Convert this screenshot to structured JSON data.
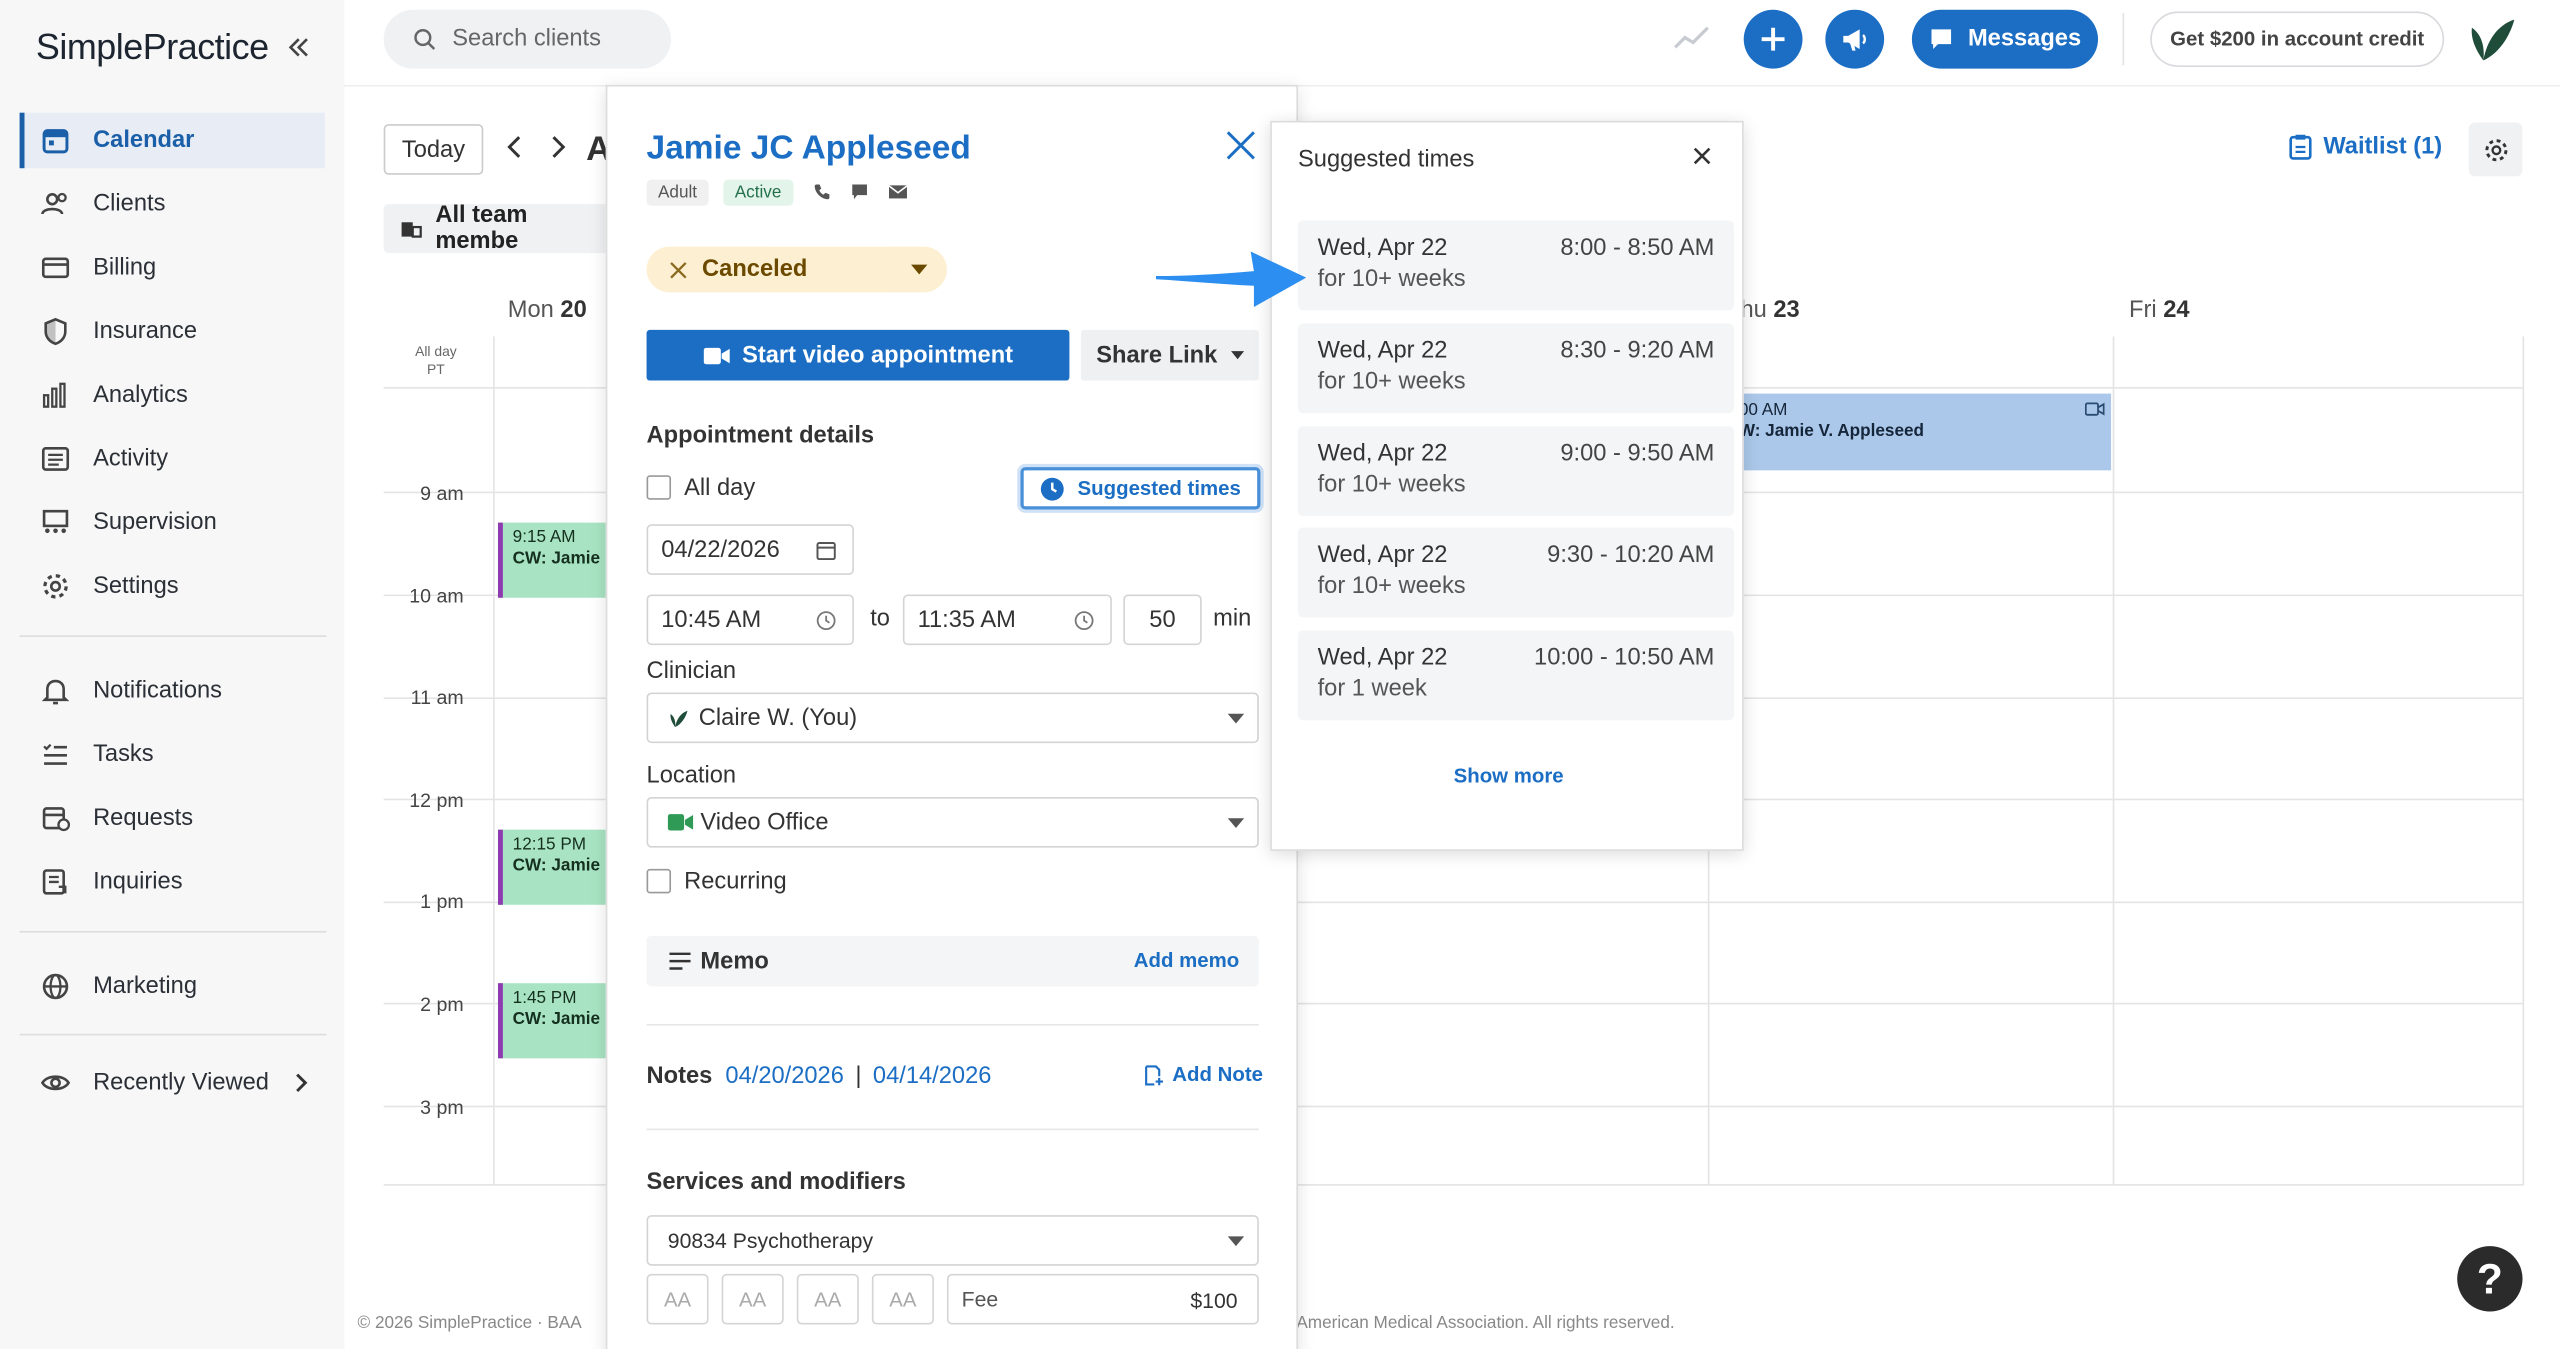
{
  "app": {
    "logo": "SimplePractice"
  },
  "sidebar": {
    "items": [
      {
        "label": "Calendar",
        "icon": "calendar-icon",
        "active": true
      },
      {
        "label": "Clients",
        "icon": "clients-icon"
      },
      {
        "label": "Billing",
        "icon": "billing-icon"
      },
      {
        "label": "Insurance",
        "icon": "shield-icon"
      },
      {
        "label": "Analytics",
        "icon": "bar-chart-icon"
      },
      {
        "label": "Activity",
        "icon": "list-icon"
      },
      {
        "label": "Supervision",
        "icon": "supervision-icon"
      },
      {
        "label": "Settings",
        "icon": "gear-icon"
      }
    ],
    "items2": [
      {
        "label": "Notifications",
        "icon": "bell-icon"
      },
      {
        "label": "Tasks",
        "icon": "tasks-icon"
      },
      {
        "label": "Requests",
        "icon": "requests-icon"
      },
      {
        "label": "Inquiries",
        "icon": "inquiries-icon"
      }
    ],
    "marketing": "Marketing",
    "recently_viewed": "Recently Viewed"
  },
  "topbar": {
    "search_placeholder": "Search clients",
    "messages": "Messages",
    "credit": "Get $200 in account credit"
  },
  "calendar": {
    "today": "Today",
    "title_partial": "A",
    "team": "All team membe",
    "all_day_1": "All day",
    "all_day_2": "PT",
    "days": [
      {
        "dow": "Mon",
        "num": "20"
      },
      {
        "dow": "hu",
        "num": "23"
      },
      {
        "dow": "Fri",
        "num": "24"
      }
    ],
    "hours": [
      "9 am",
      "10 am",
      "11 am",
      "12 pm",
      "1 pm",
      "2 pm",
      "3 pm"
    ],
    "events": [
      {
        "time": "9:15 AM",
        "title": "CW: Jamie"
      },
      {
        "time": "12:15 PM",
        "title": "CW: Jamie"
      },
      {
        "time": "1:45 PM",
        "title": "CW: Jamie"
      }
    ],
    "event_blue": {
      "time": "00 AM",
      "title": "W: Jamie V. Appleseed"
    },
    "waitlist": "Waitlist (1)",
    "footer_left": "© 2026 SimplePractice · BAA",
    "footer_right": "American Medical Association. All rights reserved."
  },
  "appointment": {
    "client_name": "Jamie JC Appleseed",
    "badges": [
      "Adult",
      "Active"
    ],
    "status": "Canceled",
    "start_video": "Start video appointment",
    "share_link": "Share Link",
    "details_title": "Appointment details",
    "all_day": "All day",
    "suggested_times_btn": "Suggested times",
    "date": "04/22/2026",
    "start_time": "10:45 AM",
    "to": "to",
    "end_time": "11:35 AM",
    "duration": "50",
    "min": "min",
    "clinician_label": "Clinician",
    "clinician": "Claire W. (You)",
    "location_label": "Location",
    "location": "Video Office",
    "recurring": "Recurring",
    "memo": "Memo",
    "add_memo": "Add memo",
    "notes_label": "Notes",
    "note1": "04/20/2026",
    "note_sep": "|",
    "note2": "04/14/2026",
    "add_note": "Add Note",
    "services_title": "Services and modifiers",
    "service": "90834 Psychotherapy",
    "modifier": "AA",
    "fee_label": "Fee",
    "fee": "$100"
  },
  "suggested": {
    "title": "Suggested times",
    "slots": [
      {
        "date": "Wed, Apr 22",
        "time": "8:00 - 8:50 AM",
        "window": "for 10+ weeks"
      },
      {
        "date": "Wed, Apr 22",
        "time": "8:30 - 9:20 AM",
        "window": "for 10+ weeks"
      },
      {
        "date": "Wed, Apr 22",
        "time": "9:00 - 9:50 AM",
        "window": "for 10+ weeks"
      },
      {
        "date": "Wed, Apr 22",
        "time": "9:30 - 10:20 AM",
        "window": "for 10+ weeks"
      },
      {
        "date": "Wed, Apr 22",
        "time": "10:00 - 10:50 AM",
        "window": "for 1 week"
      }
    ],
    "show_more": "Show more"
  },
  "colors": {
    "accent": "#1b6ec4",
    "event_green": "#a8e4c3",
    "event_purple": "#8e3ab0",
    "event_blue": "#abc8ea",
    "status_bg": "#fdf0d2"
  }
}
